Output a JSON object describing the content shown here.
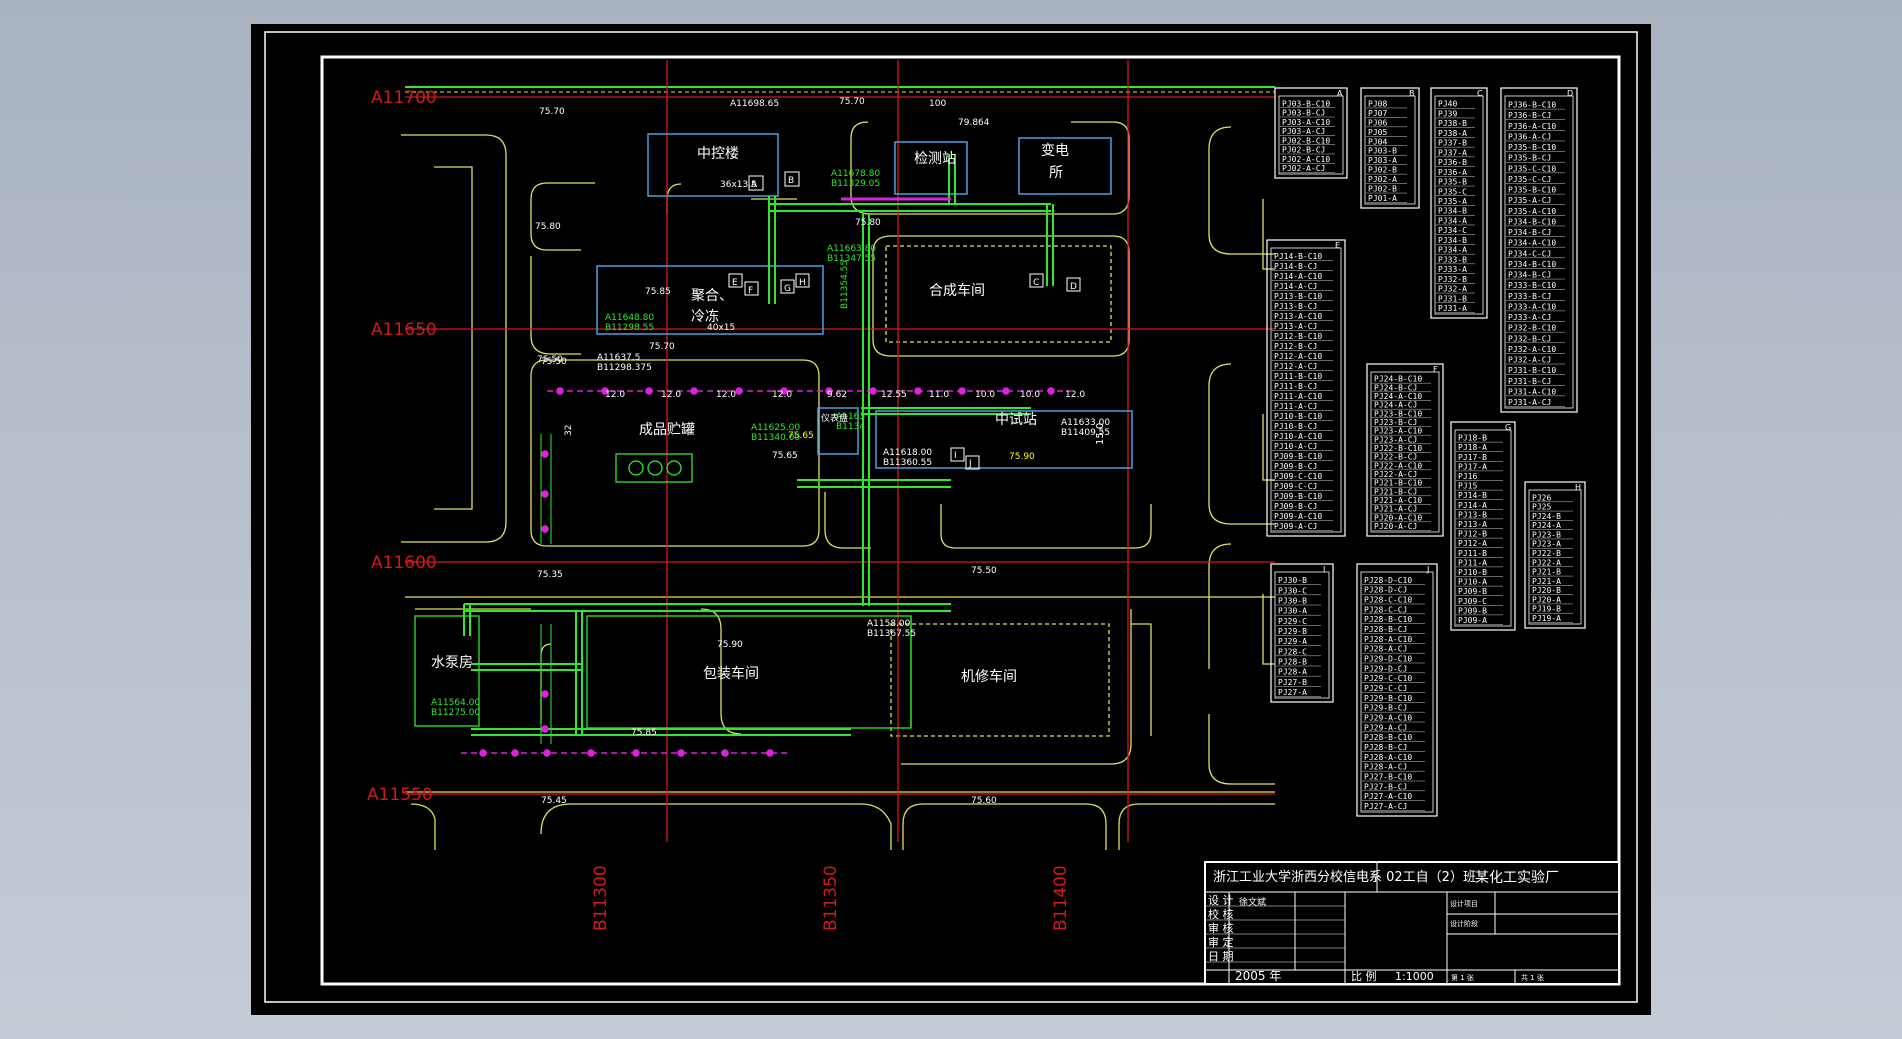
{
  "colors": {
    "background": "#000000",
    "frame": "#ffffff",
    "axis": "#d11a1a",
    "road": "#e0e060",
    "building": "#4aa0e0",
    "pipe": "#2ee82e",
    "marker": "#e020e0",
    "table_text": "#ffffff"
  },
  "grid_labels": {
    "a": [
      "A11700",
      "A11650",
      "A11600",
      "A11550"
    ],
    "b": [
      "B11300",
      "B11350",
      "B11400"
    ]
  },
  "buildings": {
    "zhongkong": "中控楼",
    "jiance": "检测站",
    "biandian_1": "变电",
    "biandian_2": "所",
    "juhe_1": "聚合、",
    "juhe_2": "冷冻",
    "hecheng": "合成车间",
    "chengpin": "成品贮罐",
    "zhongshi": "中试站",
    "shuibeng": "水泵房",
    "baozhuang": "包装车间",
    "jixiu": "机修车间"
  },
  "annotations": {
    "e1": "75.70",
    "e2": "75.70",
    "e3": "75.80",
    "e4": "75.85",
    "e5": "75.50",
    "e6": "75.70",
    "e7": "75.50",
    "e8": "75.35",
    "e9": "75.65",
    "e10": "75.90",
    "e11": "75.85",
    "e12": "75.45",
    "e13": "75.60",
    "e14": "75.80",
    "e15": "75.90",
    "e16": "75.65",
    "e17": "75.50",
    "c1": "A11698.65",
    "c2": "A11678.80",
    "c3": "B11329.05",
    "c4": "A11663.80",
    "c5": "B11347.55",
    "c6": "A11648.80",
    "c7": "B11298.55",
    "c8": "A11637.5",
    "c9": "B11298.375",
    "c10": "A11625.00",
    "c11": "B11340.00",
    "c12": "A11618.00",
    "c13": "B11360.55",
    "c14": "A11633.00",
    "c15": "B11409.55",
    "c16": "A11564.00",
    "c17": "B11275.00",
    "c18": "A1158.00",
    "c19": "B11367.55",
    "c20": "B11354.55",
    "c21": "A1163",
    "c22": "B1134",
    "d1": "100",
    "d2": "79.864",
    "d3": "36x13.5",
    "d4": "40x15",
    "s1": "12.0",
    "s2": "12.0",
    "s3": "12.0",
    "s4": "12.0",
    "s5": "9.62",
    "s6": "12.55",
    "s7": "11.0",
    "s8": "10.0",
    "s9": "10.0",
    "s10": "12.0",
    "v1": "15.0",
    "v2": "32",
    "t1": "A",
    "t2": "B",
    "t3": "E",
    "t4": "F",
    "t5": "G",
    "t6": "H",
    "t7": "C",
    "t8": "D",
    "t9": "I",
    "t10": "J",
    "box": "仪表盘"
  },
  "tables": [
    {
      "id": "A",
      "rows": [
        "PJ03-B-C10",
        "PJ03-B-CJ",
        "PJ03-A-C10",
        "PJ03-A-CJ",
        "PJ02-B-C10",
        "PJ02-B-CJ",
        "PJ02-A-C10",
        "PJ02-A-CJ"
      ]
    },
    {
      "id": "B",
      "rows": [
        "PJ08",
        "PJ07",
        "PJ06",
        "PJ05",
        "PJ04",
        "PJ03-B",
        "PJ03-A",
        "PJ02-B",
        "PJ02-A",
        "PJ02-B",
        "PJ01-A"
      ]
    },
    {
      "id": "C",
      "rows": [
        "PJ40",
        "PJ39",
        "PJ38-B",
        "PJ38-A",
        "PJ37-B",
        "PJ37-A",
        "PJ36-B",
        "PJ36-A",
        "PJ35-B",
        "PJ35-C",
        "PJ35-A",
        "PJ34-B",
        "PJ34-A",
        "PJ34-C",
        "PJ34-B",
        "PJ34-A",
        "PJ33-B",
        "PJ33-A",
        "PJ32-B",
        "PJ32-A",
        "PJ31-B",
        "PJ31-A"
      ]
    },
    {
      "id": "D",
      "rows": [
        "PJ36-B-C10",
        "PJ36-B-CJ",
        "PJ36-A-C10",
        "PJ36-A-CJ",
        "PJ35-B-C10",
        "PJ35-B-CJ",
        "PJ35-C-C10",
        "PJ35-C-CJ",
        "PJ35-B-C10",
        "PJ35-A-CJ",
        "PJ35-A-C10",
        "PJ34-B-C10",
        "PJ34-B-CJ",
        "PJ34-A-C10",
        "PJ34-C-CJ",
        "PJ34-B-C10",
        "PJ34-B-CJ",
        "PJ33-B-C10",
        "PJ33-B-CJ",
        "PJ33-A-C10",
        "PJ33-A-CJ",
        "PJ32-B-C10",
        "PJ32-B-CJ",
        "PJ32-A-C10",
        "PJ32-A-CJ",
        "PJ31-B-C10",
        "PJ31-B-CJ",
        "PJ31-A-C10",
        "PJ31-A-CJ"
      ]
    },
    {
      "id": "E",
      "rows": [
        "PJ14-B-C10",
        "PJ14-B-CJ",
        "PJ14-A-C10",
        "PJ14-A-CJ",
        "PJ13-B-C10",
        "PJ13-B-CJ",
        "PJ13-A-C10",
        "PJ13-A-CJ",
        "PJ12-B-C10",
        "PJ12-B-CJ",
        "PJ12-A-C10",
        "PJ12-A-CJ",
        "PJ11-B-C10",
        "PJ11-B-CJ",
        "PJ11-A-C10",
        "PJ11-A-CJ",
        "PJ10-B-C10",
        "PJ10-B-CJ",
        "PJ10-A-C10",
        "PJ10-A-CJ",
        "PJ09-B-C10",
        "PJ09-B-CJ",
        "PJ09-C-C10",
        "PJ09-C-CJ",
        "PJ09-B-C10",
        "PJ09-B-CJ",
        "PJ09-A-C10",
        "PJ09-A-CJ"
      ]
    },
    {
      "id": "F",
      "rows": [
        "PJ24-B-C10",
        "PJ24-B-CJ",
        "PJ24-A-C10",
        "PJ24-A-CJ",
        "PJ23-B-C10",
        "PJ23-B-CJ",
        "PJ23-A-C10",
        "PJ23-A-CJ",
        "PJ22-B-C10",
        "PJ22-B-CJ",
        "PJ22-A-C10",
        "PJ22-A-CJ",
        "PJ21-B-C10",
        "PJ21-B-CJ",
        "PJ21-A-C10",
        "PJ21-A-CJ",
        "PJ20-A-C10",
        "PJ20-A-CJ"
      ]
    },
    {
      "id": "G",
      "rows": [
        "PJ18-B",
        "PJ18-A",
        "PJ17-B",
        "PJ17-A",
        "PJ16",
        "PJ15",
        "PJ14-B",
        "PJ14-A",
        "PJ13-B",
        "PJ13-A",
        "PJ12-B",
        "PJ12-A",
        "PJ11-B",
        "PJ11-A",
        "PJ10-B",
        "PJ10-A",
        "PJ09-B",
        "PJ09-C",
        "PJ09-B",
        "PJ09-A"
      ]
    },
    {
      "id": "H",
      "rows": [
        "PJ26",
        "PJ25",
        "PJ24-B",
        "PJ24-A",
        "PJ23-B",
        "PJ23-A",
        "PJ22-B",
        "PJ22-A",
        "PJ21-B",
        "PJ21-A",
        "PJ20-B",
        "PJ20-A",
        "PJ19-B",
        "PJ19-A"
      ]
    },
    {
      "id": "I",
      "rows": [
        "PJ30-B",
        "PJ30-C",
        "PJ30-B",
        "PJ30-A",
        "PJ29-C",
        "PJ29-B",
        "PJ29-A",
        "PJ28-C",
        "PJ28-B",
        "PJ28-A",
        "PJ27-B",
        "PJ27-A"
      ]
    },
    {
      "id": "J",
      "rows": [
        "PJ28-D-C10",
        "PJ28-D-CJ",
        "PJ28-C-C10",
        "PJ28-C-CJ",
        "PJ28-B-C10",
        "PJ28-B-CJ",
        "PJ28-A-C10",
        "PJ28-A-CJ",
        "PJ29-D-C10",
        "PJ29-D-CJ",
        "PJ29-C-C10",
        "PJ29-C-CJ",
        "PJ29-B-C10",
        "PJ29-B-CJ",
        "PJ29-A-C10",
        "PJ29-A-CJ",
        "PJ28-B-C10",
        "PJ28-B-CJ",
        "PJ28-A-C10",
        "PJ28-A-CJ",
        "PJ27-B-C10",
        "PJ27-B-CJ",
        "PJ27-A-C10",
        "PJ27-A-CJ"
      ]
    }
  ],
  "title_block": {
    "school": "浙江工业大学浙西分校信电系 02工自（2）班",
    "drawing": "某化工实验厂",
    "r_design": "设 计",
    "r_check": "校 核",
    "r_review": "审 核",
    "r_approve": "审 定",
    "r_date": "日 期",
    "designer": "徐文斌",
    "year": "2005 年",
    "scale_label": "比 例",
    "scale": "1:1000",
    "sheet": "第 1 张",
    "total": "共 1 张",
    "project": "设计项目",
    "stage": "设计阶段"
  }
}
